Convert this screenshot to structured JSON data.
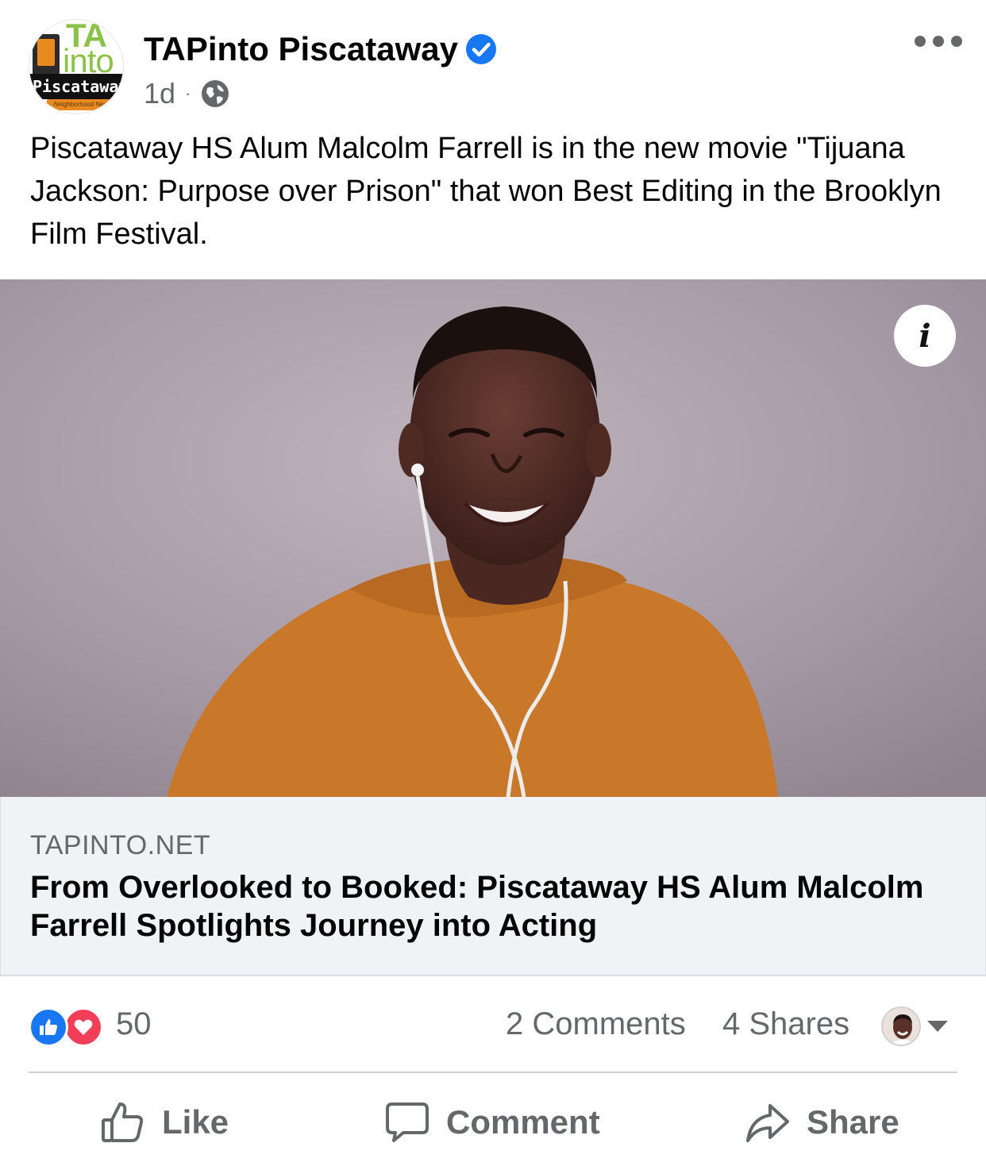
{
  "post": {
    "page_name": "TAPinto Piscataway",
    "timestamp": "1d",
    "separator": "·",
    "privacy_icon": "globe-icon",
    "verified_icon": "verified-badge-icon",
    "text": "Piscataway HS Alum Malcolm Farrell is in the new movie \"Tijuana Jackson: Purpose over Prison\" that won Best Editing in the Brooklyn Film Festival."
  },
  "avatar_logo": {
    "line1": "TA",
    "line2": "into",
    "band": "Piscataway",
    "sub": "Neighborhood News"
  },
  "link_preview": {
    "domain": "TAPINTO.NET",
    "title": "From Overlooked to Booked: Piscataway HS Alum Malcolm Farrell Spotlights Journey into Acting",
    "info_label": "i"
  },
  "engagement": {
    "reactions_count": "50",
    "comments": "2 Comments",
    "shares": "4 Shares",
    "reaction_icons": [
      "like-reaction-icon",
      "love-reaction-icon"
    ]
  },
  "actions": {
    "like": "Like",
    "comment": "Comment",
    "share": "Share"
  },
  "colors": {
    "brand_blue": "#1877f2",
    "love_red": "#f33e58",
    "secondary_text": "#65676b",
    "link_box_bg": "#f0f2f5"
  }
}
